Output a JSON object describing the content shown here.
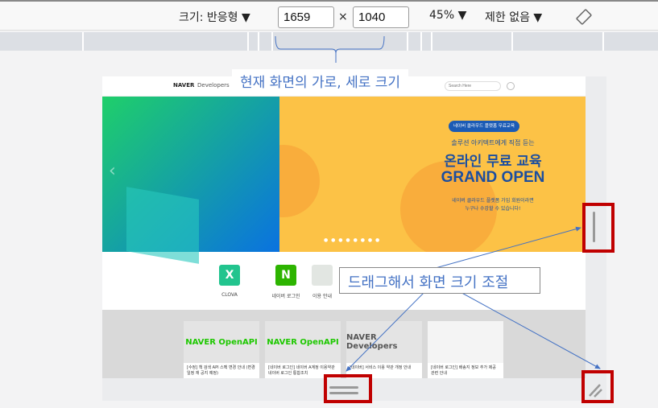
{
  "toolbar": {
    "size_label": "크기: 반응형 ▼",
    "width": "1659",
    "times": "×",
    "height": "1040",
    "zoom": "45% ▼",
    "throttle": "제한 없음 ▼",
    "rotate_icon": "rotate-icon"
  },
  "annotations": {
    "size_note": "현재 화면의 가로, 세로 크기",
    "drag_note": "드래그해서 화면 크기 조절",
    "accent": "#4472c4",
    "highlight": "#c00000"
  },
  "page": {
    "logo_bold": "NAVER",
    "logo_light": "Developers",
    "search_placeholder": "Search Here",
    "banner": {
      "pill": "네이버 클라우드 플랫폼 무료교육",
      "sub": "솔루션 아키텍트에게 직접 듣는",
      "title1": "온라인 무료 교육",
      "title2": "GRAND OPEN",
      "desc1": "네이버 클라우드 플랫폼 가입 회원이라면",
      "desc2": "누구나 수강할 수 있습니다!"
    },
    "apps": [
      {
        "label": "CLOVA",
        "icon": "X"
      },
      {
        "label": "네이버 로그인",
        "icon": "N"
      },
      {
        "label": "이용 안내",
        "icon": ""
      },
      {
        "label": "",
        "icon": ""
      }
    ],
    "cards": [
      {
        "img": "NAVER OpenAPI",
        "text": "[수정] 책 검색 API 스펙 변경 안내 (변경일정 재 공지 예정)"
      },
      {
        "img": "NAVER OpenAPI",
        "text": "[네이버 로그인] 네이버 A계정 이용약관 네이버 로그인 통합조치"
      },
      {
        "img": "NAVER Developers",
        "text": "[네이버] 서비스 이용 약관 개정 안내"
      },
      {
        "img": "",
        "text": "[네이버 로그인] 배송지 정보 추가 제공 관련 안내"
      }
    ]
  }
}
